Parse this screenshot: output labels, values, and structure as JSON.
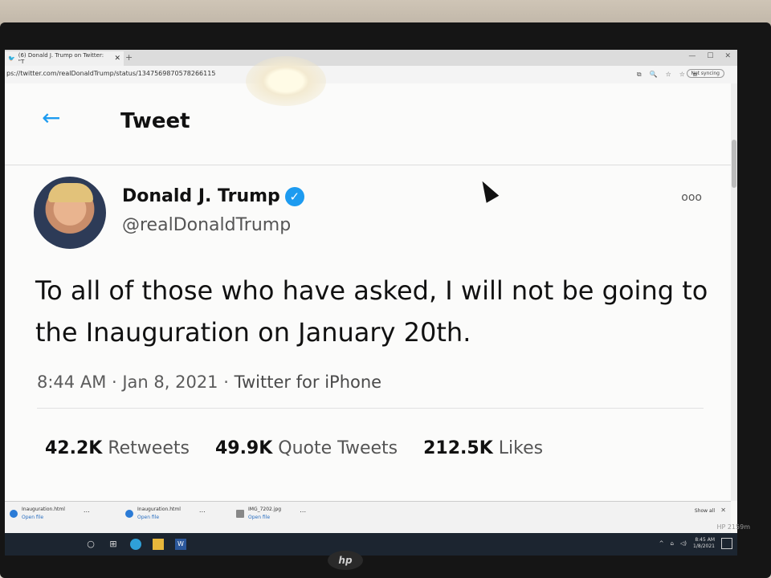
{
  "browser": {
    "tab_title": "(6) Donald J. Trump on Twitter: \"T",
    "url": "ps://twitter.com/realDonaldTrump/status/1347569870578266115",
    "not_syncing": "Not syncing"
  },
  "header": {
    "title": "Tweet"
  },
  "tweet": {
    "author_name": "Donald J. Trump",
    "handle": "@realDonaldTrump",
    "more": "ooo",
    "text": "To all of those who have asked, I will not be going to the Inauguration on January 20th.",
    "time": "8:44 AM · Jan 8, 2021",
    "separator": "·",
    "source": "Twitter for iPhone"
  },
  "stats": {
    "retweets_count": "42.2K",
    "retweets_label": "Retweets",
    "quotes_count": "49.9K",
    "quotes_label": "Quote Tweets",
    "likes_count": "212.5K",
    "likes_label": "Likes"
  },
  "downloads": {
    "items": [
      {
        "file": "Inauguration.html",
        "action": "Open file"
      },
      {
        "file": "Inauguration.html",
        "action": "Open file"
      },
      {
        "file": "IMG_7202.jpg",
        "action": "Open file"
      }
    ],
    "show_all": "Show all"
  },
  "taskbar": {
    "time": "8:45 AM",
    "date": "1/8/2021"
  },
  "monitor": {
    "brand": "hp",
    "model": "HP 2159m"
  },
  "colors": {
    "accent": "#1d9bf0"
  }
}
